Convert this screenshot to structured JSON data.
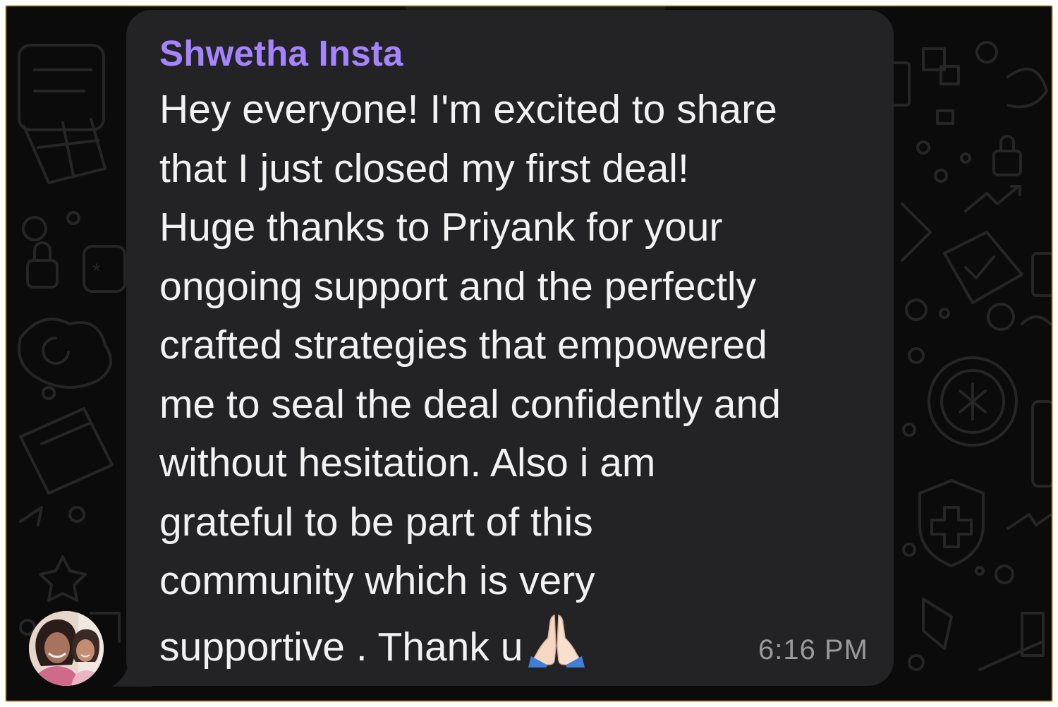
{
  "chat": {
    "sender_name": "Shwetha Insta",
    "message_lines": [
      "Hey everyone! I'm excited to share",
      "that I just closed my first deal!",
      "Huge thanks to Priyank for your",
      "ongoing support and the perfectly",
      "crafted strategies that empowered",
      "me to seal the deal confidently and",
      "without hesitation. Also i am",
      "grateful to be part of this",
      "community which is very",
      "supportive . Thank u"
    ],
    "emoji": "folded-hands-emoji",
    "timestamp": "6:16 PM"
  },
  "colors": {
    "background": "#0b0b0b",
    "bubble": "#232325",
    "sender_name": "#a684ff",
    "message_text": "#f2f2f2",
    "timestamp": "#9a9a9e",
    "frame_border": "#d8b36a"
  }
}
